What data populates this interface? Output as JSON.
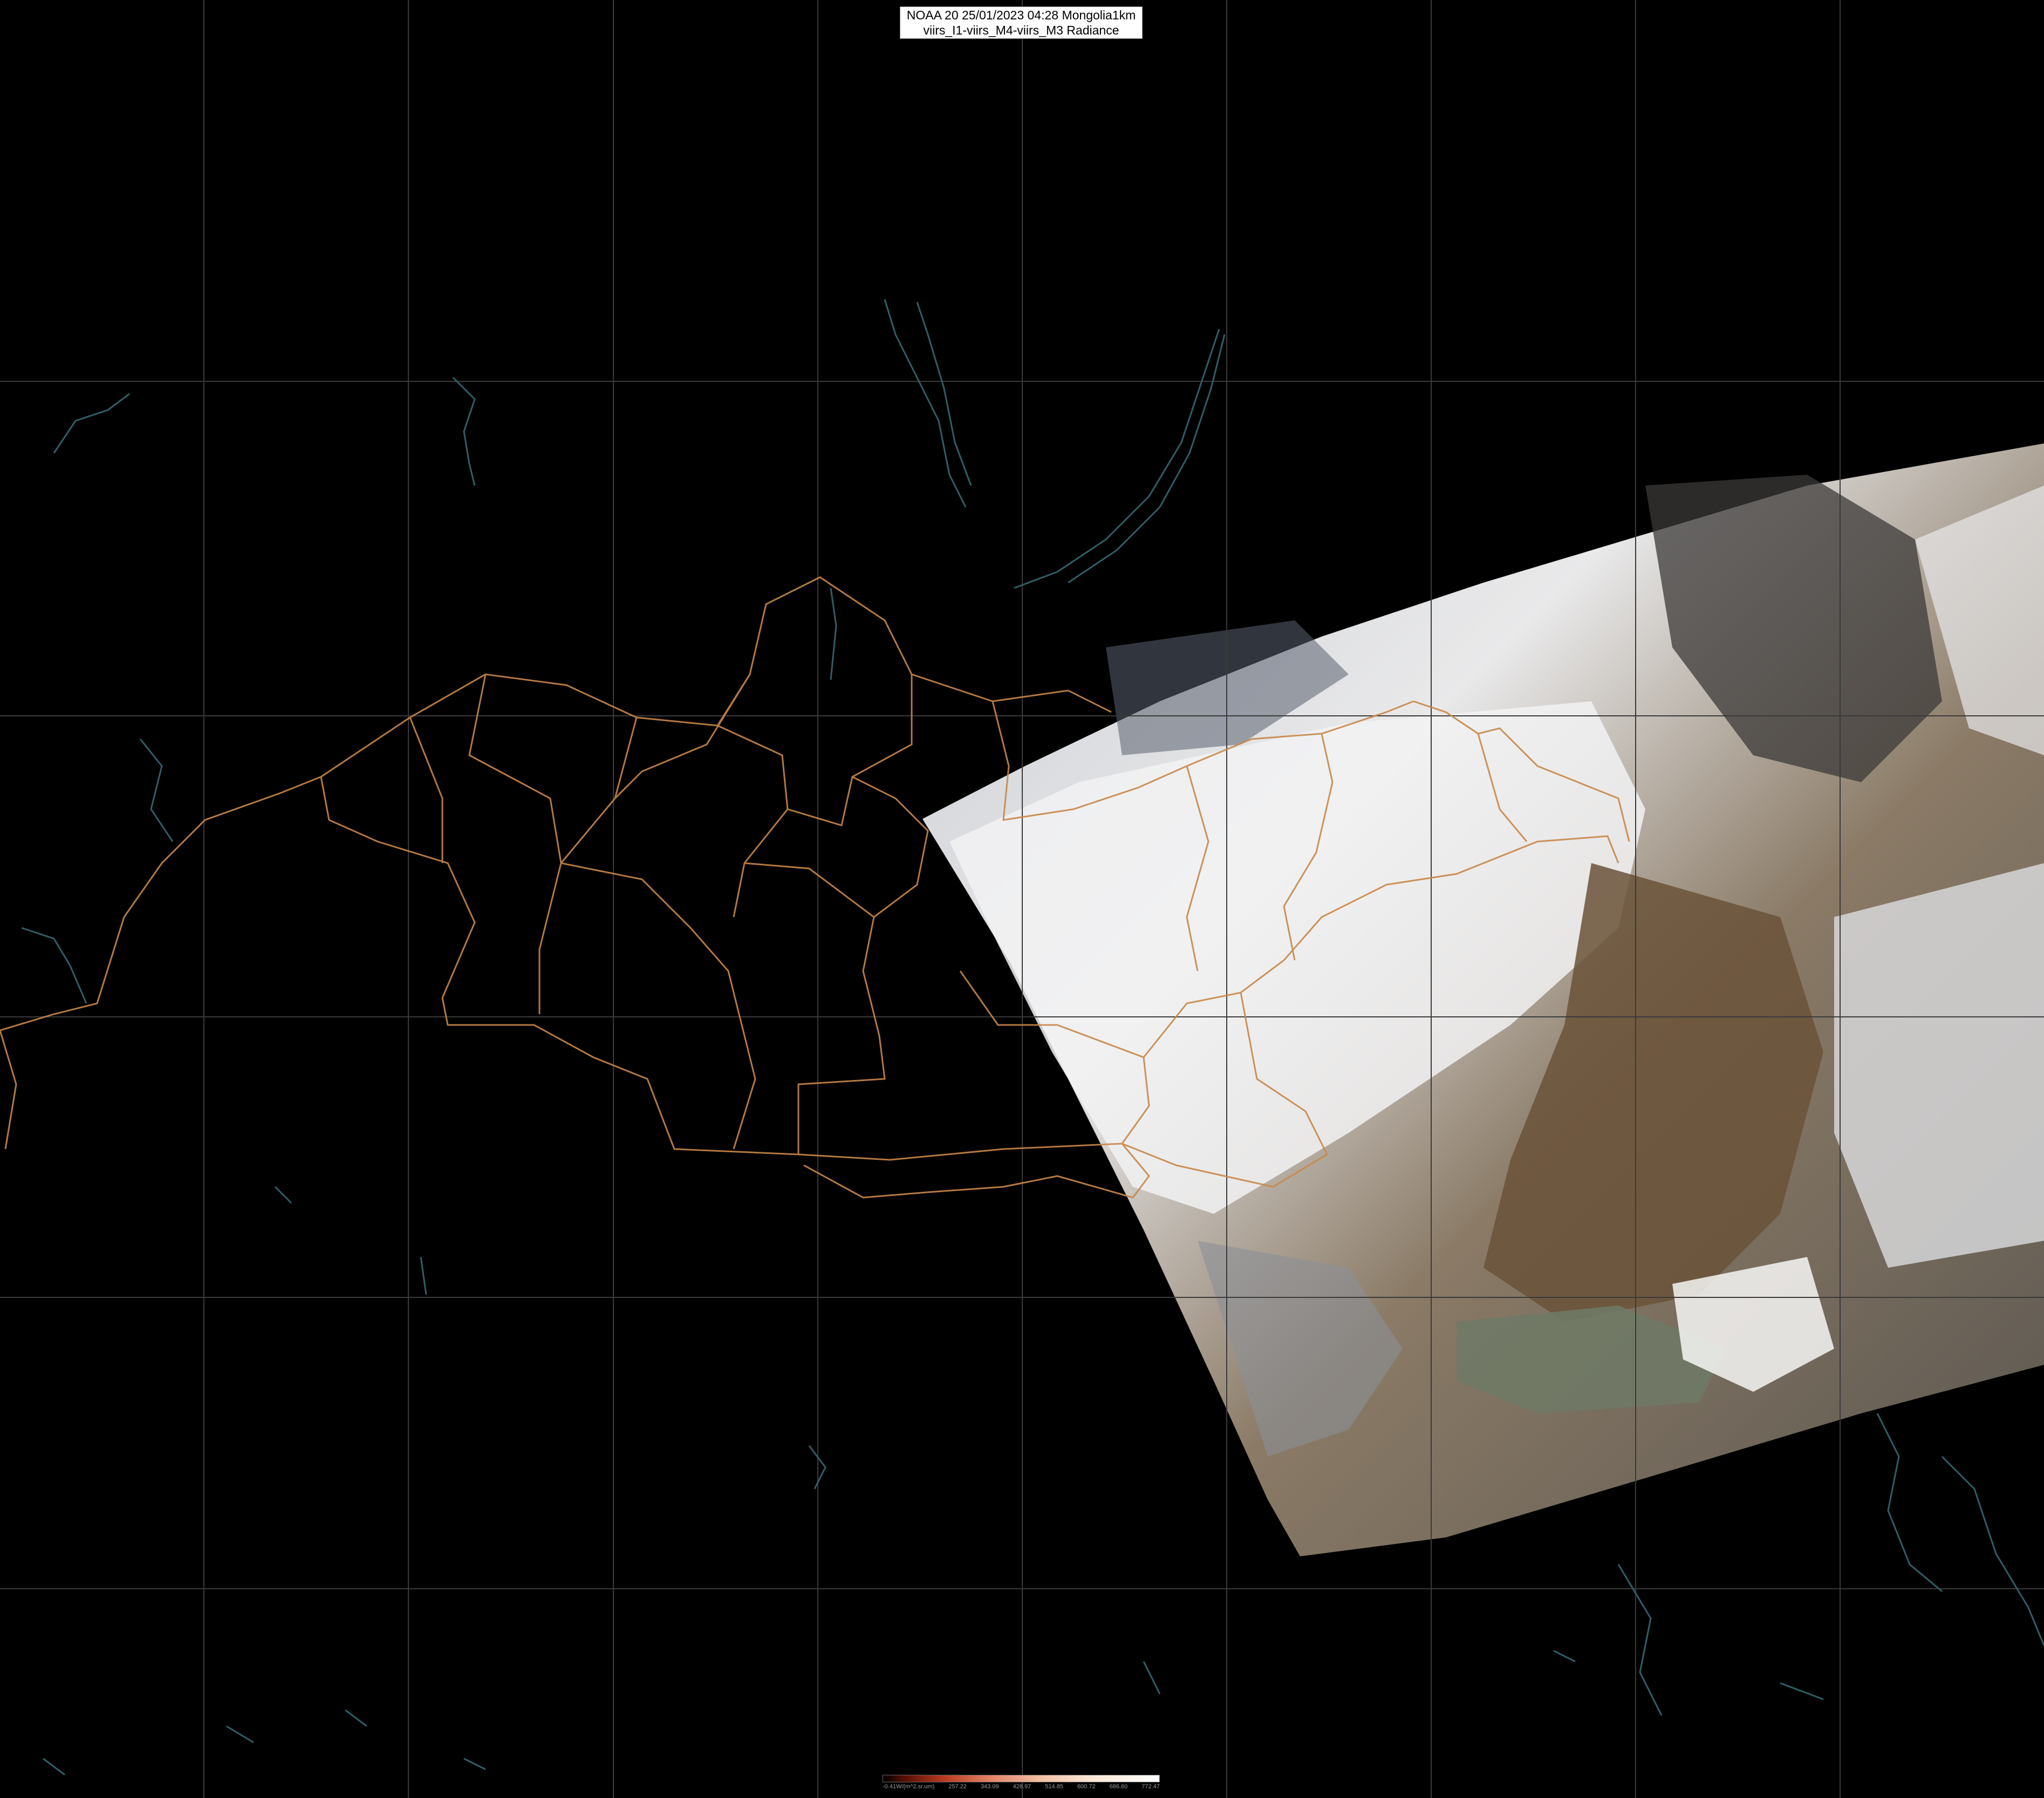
{
  "title": {
    "line1": "NOAA 20 25/01/2023 04:28 Mongolia1km",
    "line2": "viirs_I1-viirs_M4-viirs_M3 Radiance"
  },
  "legend": {
    "labels": [
      "-0.41W/(m^2.sr.um)",
      "257.22",
      "343.09",
      "428.97",
      "514.85",
      "600.72",
      "686.60",
      "772.47"
    ]
  },
  "colors": {
    "background": "#000000",
    "graticule": "#3a3a3a",
    "borders": "#c8874a",
    "coastline": "#2f5f68",
    "title_bg": "#ffffff"
  },
  "icons": [
    "graticule-grid",
    "province-borders",
    "water-outlines",
    "satellite-swath"
  ]
}
